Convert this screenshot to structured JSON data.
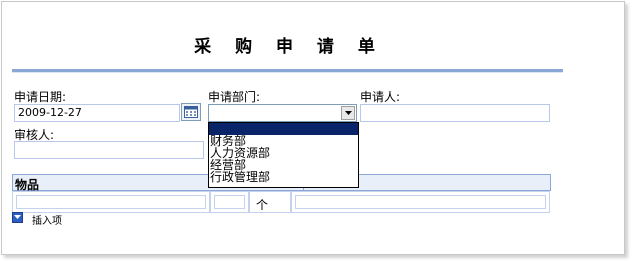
{
  "form": {
    "title": "采 购 申 请 单",
    "date_label": "申请日期:",
    "date_value": "2009-12-27",
    "dept_label": "申请部门:",
    "dept_selected": "",
    "applicant_label": "申请人:",
    "applicant_value": "",
    "reviewer_label": "审核人:",
    "reviewer_value": ""
  },
  "dropdown": {
    "options": [
      "",
      "财务部",
      "人力资源部",
      "经营部",
      "行政管理部"
    ],
    "highlighted_index": 0
  },
  "items_section": {
    "header": "物品",
    "unit_text": "个"
  },
  "insert": {
    "label": "插入项"
  },
  "colors": {
    "accent_rule": "#8aa7d8",
    "input_border": "#b9c8e6",
    "dropdown_highlight": "#0a246a",
    "insert_icon": "#2b5fc3"
  }
}
